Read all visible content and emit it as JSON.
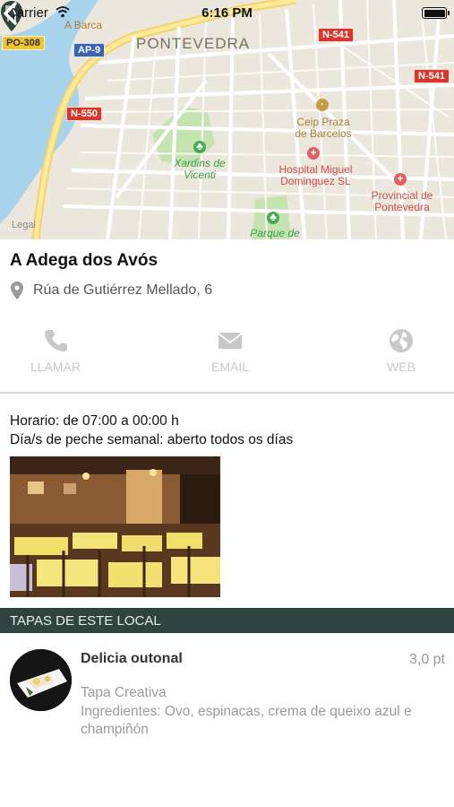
{
  "status_bar": {
    "carrier": "Carrier",
    "time": "6:16 PM"
  },
  "map": {
    "city_label": "PONTEVEDRA",
    "road_badges": [
      "PO-308",
      "AP-9",
      "N-541",
      "N-541",
      "N-550",
      "A Barca"
    ],
    "labels": {
      "barca": "A Barca",
      "ceip": "Ceip Praza de Barcelos",
      "hospital": "Hospital Miguel Dominguez SL",
      "provincial": "Provincial de Pontevedra",
      "xardins": "Xardins de Vicenti",
      "parque": "Parque de",
      "legal": "Legal"
    }
  },
  "place": {
    "name": "A Adega dos Avós",
    "address": "Rúa de Gutiérrez Mellado, 6"
  },
  "actions": {
    "call": "LLAMAR",
    "email": "EMAIL",
    "web": "WEB"
  },
  "info": {
    "hours": "Horario: de 07:00 a 00:00 h",
    "closing": "Día/s de peche semanal: aberto todos os días"
  },
  "section_title": "TAPAS DE ESTE LOCAL",
  "tapas": [
    {
      "name": "Delicia outonal",
      "price": "3,0 pt",
      "type": "Tapa Creativa",
      "ingredients": "Ingredientes: Ovo, espinacas, crema de queixo azul e champiñón"
    }
  ],
  "colors": {
    "section_bar": "#2f443f",
    "action_gray": "#c8c8c8",
    "road_red": "#d8382c"
  }
}
